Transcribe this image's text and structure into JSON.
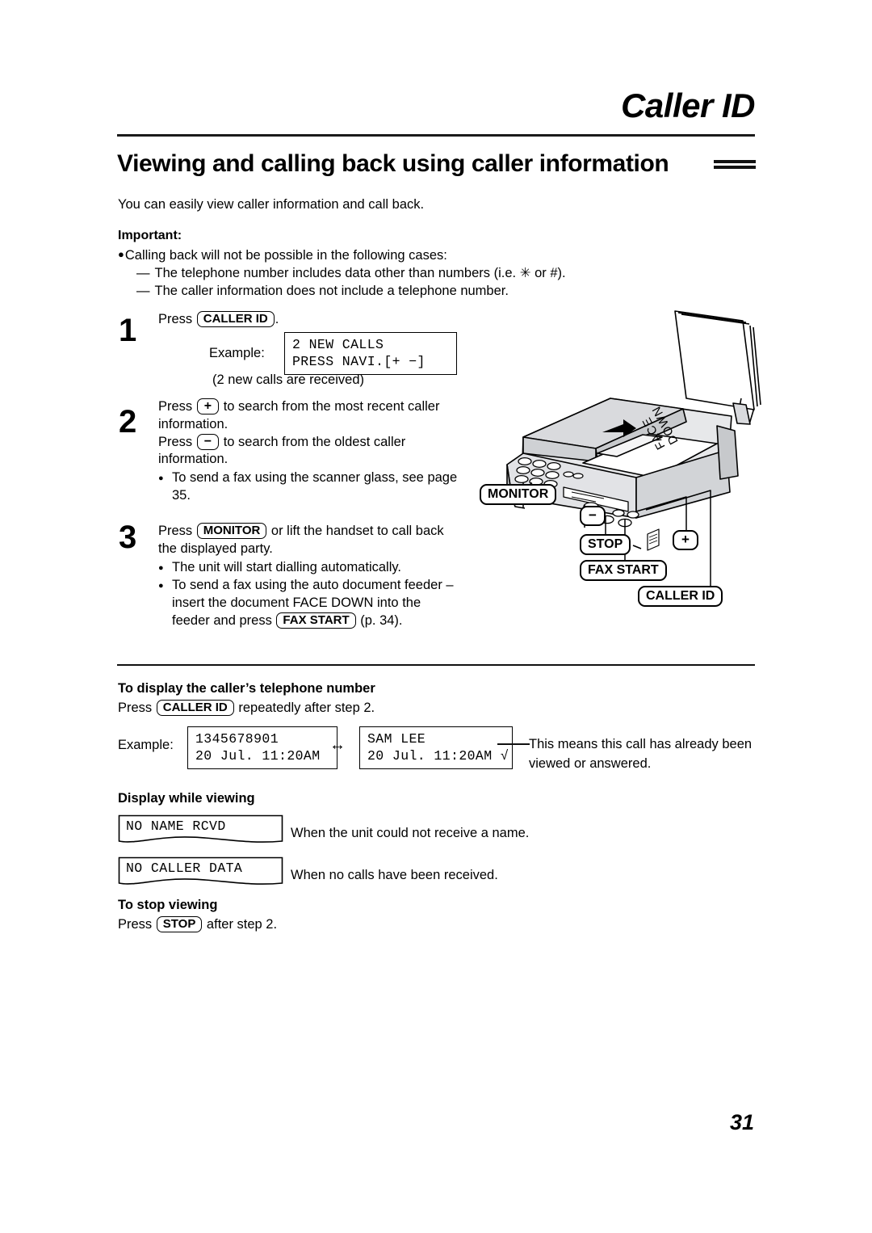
{
  "header": {
    "chapter_title": "Caller ID",
    "section_title": "Viewing and calling back using caller information"
  },
  "intro": "You can easily view caller information and call back.",
  "important": {
    "heading": "Important:",
    "bullet": "Calling back will not be possible in the following cases:",
    "dash_items": [
      "The telephone number includes data other than numbers (i.e.  ✳  or #).",
      "The caller information does not include a telephone number."
    ]
  },
  "steps": [
    {
      "number": "1",
      "text_before_key": "Press ",
      "key": "CALLER ID",
      "text_after_key": ".",
      "example_label": "Example:",
      "lcd_line1": "2 NEW CALLS",
      "lcd_line2": "PRESS NAVI.[+ −]",
      "lcd_note": "(2 new calls are received)"
    },
    {
      "number": "2",
      "line1_a": "Press ",
      "key_plus": "+",
      "line1_b": " to search from the most recent caller information.",
      "line2_a": "Press ",
      "key_minus": "−",
      "line2_b": " to search from the oldest caller information.",
      "sub_bullet": "To send a fax using the scanner glass, see page 35."
    },
    {
      "number": "3",
      "line1_a": "Press ",
      "key_monitor": "MONITOR",
      "line1_b": " or lift the handset to call back the displayed party.",
      "sub_bullet_1": "The unit will start dialling automatically.",
      "sub_bullet_2a": "To send a fax using the auto document feeder – insert the document FACE DOWN into the feeder and press ",
      "key_faxstart": "FAX START",
      "sub_bullet_2b": " (p. 34)."
    }
  ],
  "sections": [
    {
      "heading": "To display the caller’s telephone number",
      "line_a": "Press ",
      "key": "CALLER ID",
      "line_b": " repeatedly after step 2.",
      "example_label": "Example:",
      "lcd_a_line1": "1345678901",
      "lcd_a_line2": "20 Jul. 11:20AM",
      "arrow": "↔",
      "lcd_b_line1": "SAM LEE",
      "lcd_b_line2": "20 Jul. 11:20AM √",
      "leader_note": "This means this call has already been viewed or answered."
    },
    {
      "heading": "Display while viewing",
      "displays": [
        {
          "text": "NO NAME RCVD",
          "note": "When the unit could not receive a name."
        },
        {
          "text": "NO CALLER DATA",
          "note": "When no calls have been received."
        }
      ]
    },
    {
      "heading": "To stop viewing",
      "line_a": "Press ",
      "key": "STOP",
      "line_b": " after step 2."
    }
  ],
  "illustration": {
    "face_down_label_1": "FACE",
    "face_down_label_2": "DOWN",
    "callouts": [
      {
        "id": "monitor",
        "label": "MONITOR"
      },
      {
        "id": "minus",
        "label": "−"
      },
      {
        "id": "stop",
        "label": "STOP"
      },
      {
        "id": "plus",
        "label": "+"
      },
      {
        "id": "faxstart",
        "label": "FAX START"
      },
      {
        "id": "callerid",
        "label": "CALLER ID"
      }
    ]
  },
  "page_number": "31",
  "colors": {
    "ink": "#000000",
    "paper": "#ffffff",
    "illustration_fill": "#d9dadd",
    "illustration_fill_light": "#eceded"
  }
}
